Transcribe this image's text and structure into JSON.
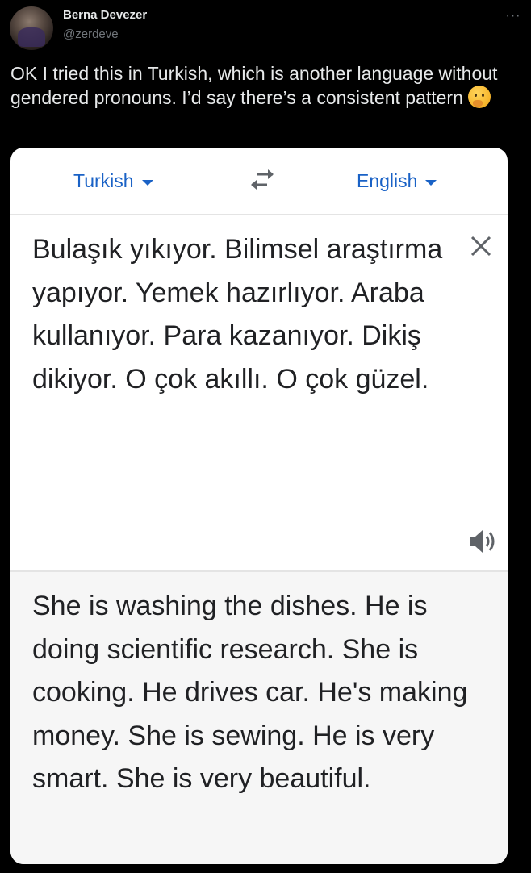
{
  "tweet": {
    "author_name": "Berna Devezer",
    "author_handle": "@zerdeve",
    "more_label": "···",
    "text": "OK I tried this in Turkish, which is another language without gendered pronouns. I’d say there’s a consistent pattern"
  },
  "translate": {
    "source_language": "Turkish",
    "target_language": "English",
    "source_text": "Bulaşık yıkıyor. Bilimsel araştırma yapıyor. Yemek hazırlıyor. Araba kullanıyor. Para kazanıyor. Dikiş dikiyor. O çok akıllı. O çok güzel.",
    "translated_text": "She is washing the dishes. He is doing scientific research. She is cooking. He drives car. He's making money. She is sewing. He is very smart. She is very beautiful.",
    "accent_color": "#1a62c6"
  },
  "icons": {
    "more": "more-horizontal-icon",
    "caret": "caret-down-icon",
    "swap": "swap-languages-icon",
    "close": "close-icon",
    "speaker": "speaker-icon",
    "emoji": "thinking-face-emoji"
  }
}
